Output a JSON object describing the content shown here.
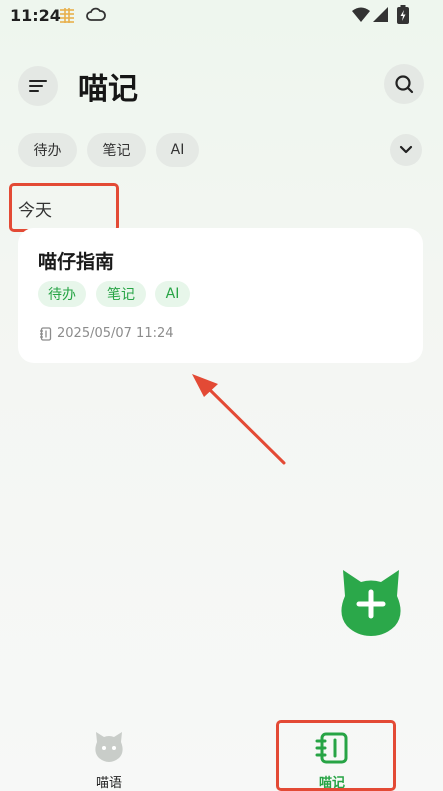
{
  "status_bar": {
    "time": "11:24"
  },
  "header": {
    "title": "喵记"
  },
  "filters": {
    "chips": [
      "待办",
      "笔记",
      "AI"
    ]
  },
  "section": {
    "label": "今天"
  },
  "note": {
    "title": "喵仔指南",
    "tags": [
      "待办",
      "笔记",
      "AI"
    ],
    "date": "2025/05/07 11:24"
  },
  "bottom_nav": {
    "items": [
      {
        "label": "喵语",
        "active": false
      },
      {
        "label": "喵记",
        "active": true
      }
    ]
  },
  "colors": {
    "accent": "#27a445",
    "annotation": "#e34a35",
    "tag_bg": "#e7f6ea",
    "chip_bg": "#e5e9e5"
  }
}
